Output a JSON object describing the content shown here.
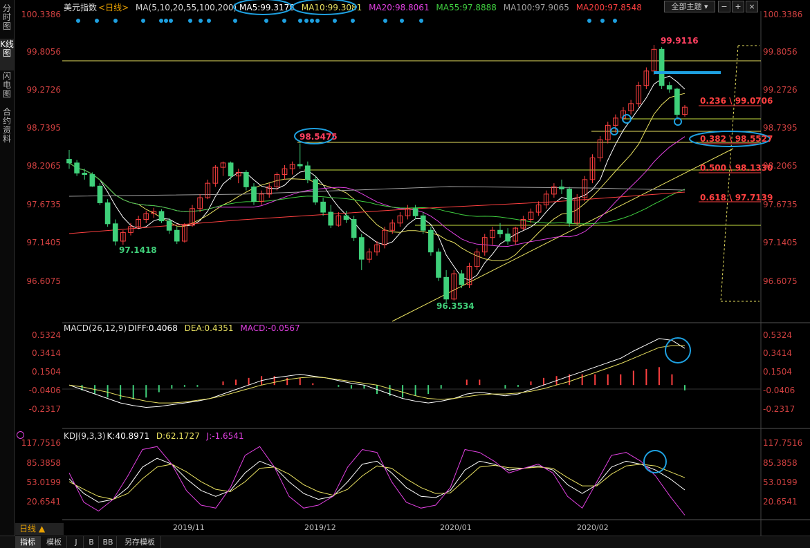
{
  "left_tabs": [
    "分时图",
    "K线图",
    "闪电图",
    "合约资料"
  ],
  "header": {
    "title": "美元指数",
    "period": "<日线>",
    "ma_legend": [
      {
        "label": "MA(5,10,20,55,100,200)",
        "color": "#d8d8d8"
      },
      {
        "label": "MA5:99.3178",
        "color": "#ffffff"
      },
      {
        "label": "MA10:99.3081",
        "color": "#e8e060"
      },
      {
        "label": "MA20:98.8061",
        "color": "#e040e0"
      },
      {
        "label": "MA55:97.8888",
        "color": "#40d040"
      },
      {
        "label": "MA100:97.9065",
        "color": "#a0a0a0"
      },
      {
        "label": "MA200:97.8548",
        "color": "#ff4040"
      }
    ],
    "button_all": "全部主题"
  },
  "price_axis": [
    "100.3386",
    "99.8056",
    "99.2726",
    "98.7395",
    "98.2065",
    "97.6735",
    "97.1405",
    "96.6075"
  ],
  "annotations": {
    "high_label": "99.9116",
    "low1_label": "97.1418",
    "low2_label": "96.3534",
    "mid_label": "98.5475",
    "fib": [
      "0.236 \\ 99.0706",
      "0.382 \\ 98.5527",
      "0.500 \\ 98.1330",
      "0.618 \\ 97.7139"
    ]
  },
  "macd": {
    "title": "MACD(26,12,9)",
    "diff": "DIFF:0.4068",
    "dea": "DEA:0.4351",
    "macd": "MACD:-0.0567",
    "axis": [
      "0.5324",
      "0.3414",
      "0.1504",
      "-0.0406",
      "-0.2317"
    ]
  },
  "kdj": {
    "title": "KDJ(9,3,3)",
    "k": "K:40.8971",
    "d": "D:62.1727",
    "j": "J:-1.6541",
    "axis": [
      "117.7516",
      "85.3858",
      "53.0199",
      "20.6541"
    ]
  },
  "dates": [
    "2019/11",
    "2019/12",
    "2020/01",
    "2020/02"
  ],
  "bottom_tabs": [
    "日线 ▲",
    "指标",
    "模板",
    "J",
    "B",
    "BB",
    "另存模板"
  ],
  "colors": {
    "up": "#ff4040",
    "down": "#3fd07a",
    "bg": "#000000",
    "ma5": "#ffffff",
    "ma10": "#e8e060",
    "ma20": "#e040e0",
    "ma55": "#40d040",
    "ma100": "#a0a0a0",
    "ma200": "#ff4040",
    "highlight": "#1ea0e0"
  },
  "chart_data": [
    {
      "type": "candlestick",
      "title": "美元指数 日线",
      "ylim": [
        96.35,
        100.34
      ],
      "x_ticks": [
        "2019/11",
        "2019/12",
        "2020/01",
        "2020/02"
      ],
      "candles": [
        {
          "o": 98.33,
          "h": 98.46,
          "l": 98.2,
          "c": 98.28
        },
        {
          "o": 98.28,
          "h": 98.32,
          "l": 98.1,
          "c": 98.14
        },
        {
          "o": 98.14,
          "h": 98.2,
          "l": 98.05,
          "c": 98.12
        },
        {
          "o": 98.12,
          "h": 98.15,
          "l": 97.95,
          "c": 97.96
        },
        {
          "o": 97.96,
          "h": 98.0,
          "l": 97.7,
          "c": 97.73
        },
        {
          "o": 97.73,
          "h": 97.78,
          "l": 97.4,
          "c": 97.44
        },
        {
          "o": 97.44,
          "h": 97.5,
          "l": 97.14,
          "c": 97.2
        },
        {
          "o": 97.2,
          "h": 97.35,
          "l": 97.15,
          "c": 97.32
        },
        {
          "o": 97.32,
          "h": 97.45,
          "l": 97.28,
          "c": 97.4
        },
        {
          "o": 97.4,
          "h": 97.55,
          "l": 97.38,
          "c": 97.5
        },
        {
          "o": 97.5,
          "h": 97.62,
          "l": 97.45,
          "c": 97.58
        },
        {
          "o": 97.58,
          "h": 97.66,
          "l": 97.52,
          "c": 97.61
        },
        {
          "o": 97.61,
          "h": 97.64,
          "l": 97.45,
          "c": 97.48
        },
        {
          "o": 97.48,
          "h": 97.52,
          "l": 97.3,
          "c": 97.35
        },
        {
          "o": 97.35,
          "h": 97.4,
          "l": 97.16,
          "c": 97.2
        },
        {
          "o": 97.2,
          "h": 97.45,
          "l": 97.18,
          "c": 97.42
        },
        {
          "o": 97.42,
          "h": 97.7,
          "l": 97.4,
          "c": 97.65
        },
        {
          "o": 97.65,
          "h": 97.85,
          "l": 97.6,
          "c": 97.8
        },
        {
          "o": 97.8,
          "h": 98.05,
          "l": 97.78,
          "c": 98.0
        },
        {
          "o": 98.0,
          "h": 98.25,
          "l": 97.95,
          "c": 98.22
        },
        {
          "o": 98.22,
          "h": 98.3,
          "l": 98.1,
          "c": 98.28
        },
        {
          "o": 98.28,
          "h": 98.3,
          "l": 98.05,
          "c": 98.1
        },
        {
          "o": 98.1,
          "h": 98.2,
          "l": 98.0,
          "c": 98.15
        },
        {
          "o": 98.15,
          "h": 98.18,
          "l": 97.9,
          "c": 97.95
        },
        {
          "o": 97.95,
          "h": 98.0,
          "l": 97.7,
          "c": 97.75
        },
        {
          "o": 97.75,
          "h": 97.9,
          "l": 97.7,
          "c": 97.85
        },
        {
          "o": 97.85,
          "h": 98.0,
          "l": 97.8,
          "c": 97.95
        },
        {
          "o": 97.95,
          "h": 98.15,
          "l": 97.9,
          "c": 98.12
        },
        {
          "o": 98.12,
          "h": 98.25,
          "l": 98.05,
          "c": 98.2
        },
        {
          "o": 98.2,
          "h": 98.3,
          "l": 98.12,
          "c": 98.26
        },
        {
          "o": 98.26,
          "h": 98.55,
          "l": 98.2,
          "c": 98.24
        },
        {
          "o": 98.24,
          "h": 98.3,
          "l": 98.0,
          "c": 98.05
        },
        {
          "o": 98.05,
          "h": 98.1,
          "l": 97.7,
          "c": 97.74
        },
        {
          "o": 97.74,
          "h": 97.8,
          "l": 97.55,
          "c": 97.6
        },
        {
          "o": 97.6,
          "h": 97.7,
          "l": 97.38,
          "c": 97.42
        },
        {
          "o": 97.42,
          "h": 97.6,
          "l": 97.4,
          "c": 97.55
        },
        {
          "o": 97.55,
          "h": 97.62,
          "l": 97.45,
          "c": 97.5
        },
        {
          "o": 97.5,
          "h": 97.55,
          "l": 97.2,
          "c": 97.25
        },
        {
          "o": 97.25,
          "h": 97.3,
          "l": 96.8,
          "c": 96.95
        },
        {
          "o": 96.95,
          "h": 97.1,
          "l": 96.9,
          "c": 97.05
        },
        {
          "o": 97.05,
          "h": 97.2,
          "l": 97.0,
          "c": 97.15
        },
        {
          "o": 97.15,
          "h": 97.4,
          "l": 97.1,
          "c": 97.35
        },
        {
          "o": 97.35,
          "h": 97.5,
          "l": 97.3,
          "c": 97.45
        },
        {
          "o": 97.45,
          "h": 97.6,
          "l": 97.4,
          "c": 97.55
        },
        {
          "o": 97.55,
          "h": 97.7,
          "l": 97.5,
          "c": 97.65
        },
        {
          "o": 97.65,
          "h": 97.7,
          "l": 97.5,
          "c": 97.55
        },
        {
          "o": 97.55,
          "h": 97.6,
          "l": 97.3,
          "c": 97.35
        },
        {
          "o": 97.35,
          "h": 97.4,
          "l": 97.0,
          "c": 97.05
        },
        {
          "o": 97.05,
          "h": 97.1,
          "l": 96.65,
          "c": 96.7
        },
        {
          "o": 96.7,
          "h": 96.8,
          "l": 96.35,
          "c": 96.4
        },
        {
          "o": 96.4,
          "h": 96.8,
          "l": 96.38,
          "c": 96.75
        },
        {
          "o": 96.75,
          "h": 96.8,
          "l": 96.55,
          "c": 96.6
        },
        {
          "o": 96.6,
          "h": 96.9,
          "l": 96.55,
          "c": 96.85
        },
        {
          "o": 96.85,
          "h": 97.1,
          "l": 96.8,
          "c": 97.05
        },
        {
          "o": 97.05,
          "h": 97.3,
          "l": 97.0,
          "c": 97.25
        },
        {
          "o": 97.25,
          "h": 97.4,
          "l": 97.15,
          "c": 97.35
        },
        {
          "o": 97.35,
          "h": 97.45,
          "l": 97.25,
          "c": 97.3
        },
        {
          "o": 97.3,
          "h": 97.38,
          "l": 97.15,
          "c": 97.2
        },
        {
          "o": 97.2,
          "h": 97.4,
          "l": 97.15,
          "c": 97.38
        },
        {
          "o": 97.38,
          "h": 97.55,
          "l": 97.35,
          "c": 97.5
        },
        {
          "o": 97.5,
          "h": 97.65,
          "l": 97.45,
          "c": 97.6
        },
        {
          "o": 97.6,
          "h": 97.75,
          "l": 97.55,
          "c": 97.7
        },
        {
          "o": 97.7,
          "h": 97.9,
          "l": 97.65,
          "c": 97.85
        },
        {
          "o": 97.85,
          "h": 98.0,
          "l": 97.8,
          "c": 97.95
        },
        {
          "o": 97.95,
          "h": 98.05,
          "l": 97.85,
          "c": 97.92
        },
        {
          "o": 97.92,
          "h": 97.95,
          "l": 97.4,
          "c": 97.45
        },
        {
          "o": 97.45,
          "h": 97.85,
          "l": 97.42,
          "c": 97.8
        },
        {
          "o": 97.8,
          "h": 98.1,
          "l": 97.75,
          "c": 98.05
        },
        {
          "o": 98.05,
          "h": 98.4,
          "l": 98.0,
          "c": 98.35
        },
        {
          "o": 98.35,
          "h": 98.65,
          "l": 98.3,
          "c": 98.6
        },
        {
          "o": 98.6,
          "h": 98.85,
          "l": 98.55,
          "c": 98.8
        },
        {
          "o": 98.8,
          "h": 98.95,
          "l": 98.7,
          "c": 98.9
        },
        {
          "o": 98.9,
          "h": 99.05,
          "l": 98.85,
          "c": 99.0
        },
        {
          "o": 99.0,
          "h": 99.15,
          "l": 98.95,
          "c": 99.1
        },
        {
          "o": 99.1,
          "h": 99.4,
          "l": 99.05,
          "c": 99.35
        },
        {
          "o": 99.35,
          "h": 99.6,
          "l": 99.3,
          "c": 99.55
        },
        {
          "o": 99.55,
          "h": 99.91,
          "l": 99.5,
          "c": 99.85
        },
        {
          "o": 99.85,
          "h": 99.88,
          "l": 99.3,
          "c": 99.35
        },
        {
          "o": 99.35,
          "h": 99.4,
          "l": 99.25,
          "c": 99.3
        },
        {
          "o": 99.3,
          "h": 99.32,
          "l": 98.9,
          "c": 98.95
        },
        {
          "o": 98.95,
          "h": 99.08,
          "l": 98.92,
          "c": 99.05
        }
      ]
    },
    {
      "type": "macd",
      "title": "MACD(26,12,9)",
      "series": [
        {
          "name": "DIFF",
          "values": [
            0.0,
            -0.05,
            -0.1,
            -0.15,
            -0.2,
            -0.23,
            -0.25,
            -0.24,
            -0.22,
            -0.2,
            -0.18,
            -0.15,
            -0.1,
            -0.05,
            0.0,
            0.05,
            0.08,
            0.1,
            0.12,
            0.1,
            0.08,
            0.05,
            0.02,
            0.0,
            -0.05,
            -0.1,
            -0.15,
            -0.18,
            -0.2,
            -0.18,
            -0.15,
            -0.1,
            -0.08,
            -0.1,
            -0.12,
            -0.1,
            -0.05,
            0.0,
            0.05,
            0.1,
            0.15,
            0.2,
            0.25,
            0.3,
            0.38,
            0.45,
            0.52,
            0.5,
            0.41
          ]
        },
        {
          "name": "DEA",
          "values": [
            0.0,
            -0.02,
            -0.05,
            -0.08,
            -0.12,
            -0.15,
            -0.18,
            -0.2,
            -0.2,
            -0.19,
            -0.17,
            -0.15,
            -0.12,
            -0.08,
            -0.04,
            0.0,
            0.03,
            0.06,
            0.08,
            0.09,
            0.08,
            0.06,
            0.04,
            0.02,
            0.0,
            -0.04,
            -0.08,
            -0.12,
            -0.15,
            -0.16,
            -0.15,
            -0.13,
            -0.11,
            -0.1,
            -0.1,
            -0.09,
            -0.07,
            -0.04,
            0.0,
            0.04,
            0.09,
            0.14,
            0.19,
            0.24,
            0.3,
            0.36,
            0.42,
            0.44,
            0.44
          ]
        },
        {
          "name": "MACD",
          "values": [
            0.0,
            -0.06,
            -0.1,
            -0.14,
            -0.16,
            -0.16,
            -0.14,
            -0.08,
            -0.04,
            -0.02,
            -0.02,
            0.0,
            0.04,
            0.06,
            0.08,
            0.1,
            0.1,
            0.08,
            0.08,
            0.02,
            0.0,
            -0.02,
            -0.04,
            -0.04,
            -0.1,
            -0.12,
            -0.14,
            -0.12,
            -0.1,
            -0.04,
            0.0,
            0.06,
            0.06,
            0.0,
            -0.04,
            -0.02,
            0.04,
            0.08,
            0.1,
            0.12,
            0.12,
            0.12,
            0.12,
            0.12,
            0.16,
            0.18,
            0.2,
            0.12,
            -0.06
          ]
        }
      ]
    },
    {
      "type": "kdj",
      "title": "KDJ(9,3,3)",
      "series": [
        {
          "name": "K",
          "values": [
            60,
            35,
            20,
            25,
            45,
            80,
            95,
            85,
            60,
            40,
            30,
            40,
            70,
            90,
            80,
            55,
            35,
            25,
            30,
            55,
            85,
            90,
            70,
            45,
            30,
            28,
            40,
            75,
            90,
            85,
            75,
            78,
            82,
            75,
            50,
            35,
            50,
            80,
            90,
            85,
            75,
            60,
            41
          ]
        },
        {
          "name": "D",
          "values": [
            55,
            42,
            30,
            25,
            35,
            60,
            80,
            85,
            72,
            55,
            42,
            38,
            55,
            78,
            80,
            68,
            50,
            38,
            32,
            42,
            65,
            82,
            78,
            60,
            45,
            35,
            36,
            58,
            80,
            83,
            79,
            78,
            80,
            78,
            62,
            48,
            48,
            68,
            82,
            85,
            82,
            72,
            62
          ]
        },
        {
          "name": "J",
          "values": [
            70,
            20,
            5,
            25,
            65,
            110,
            115,
            85,
            40,
            15,
            10,
            45,
            100,
            115,
            80,
            30,
            10,
            15,
            30,
            80,
            110,
            105,
            55,
            20,
            10,
            15,
            45,
            110,
            105,
            90,
            70,
            78,
            85,
            70,
            30,
            10,
            55,
            100,
            105,
            90,
            65,
            30,
            -2
          ]
        }
      ]
    }
  ]
}
